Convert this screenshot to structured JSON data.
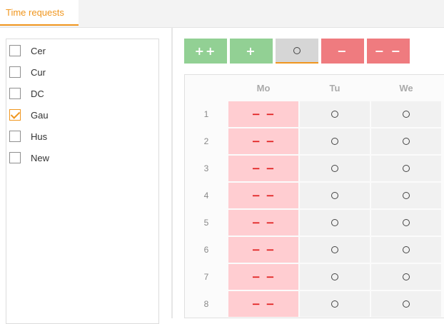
{
  "tabs": [
    {
      "label": "Time requests",
      "active": true
    }
  ],
  "employees": [
    {
      "label": "Cer",
      "checked": false
    },
    {
      "label": "Cur",
      "checked": false
    },
    {
      "label": "DC",
      "checked": false
    },
    {
      "label": "Gau",
      "checked": true
    },
    {
      "label": "Hus",
      "checked": false
    },
    {
      "label": "New",
      "checked": false
    }
  ],
  "toolbar": {
    "buttons": [
      {
        "label": "++",
        "color": "#92d094"
      },
      {
        "label": "+",
        "color": "#92d094"
      },
      {
        "label": "ring-icon",
        "color": "#d6d6d6",
        "selected": true
      },
      {
        "label": "−",
        "color": "#ef7b7f"
      },
      {
        "label": "− −",
        "color": "#ef7b7f"
      }
    ]
  },
  "grid": {
    "columns": [
      "Mo",
      "Tu",
      "We"
    ],
    "rows": [
      "1",
      "2",
      "3",
      "4",
      "5",
      "6",
      "7",
      "8"
    ],
    "mo_symbol": "− −",
    "other_symbol": "ring-icon"
  }
}
